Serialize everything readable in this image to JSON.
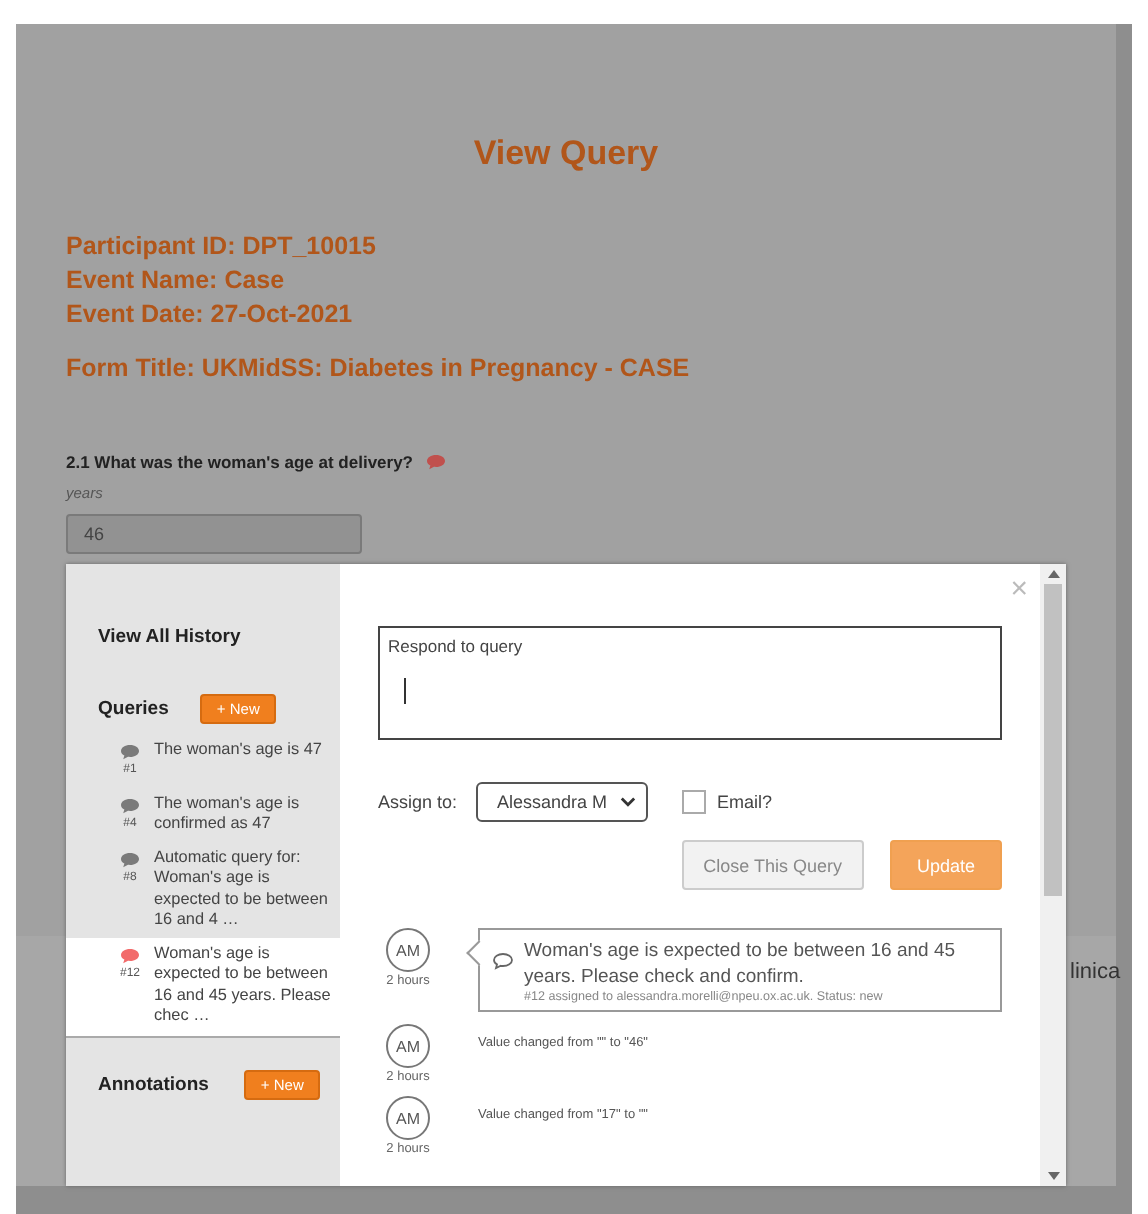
{
  "page": {
    "title": "View Query",
    "details": [
      "Participant ID: DPT_10015",
      "Event Name: Case",
      "Event Date: 27-Oct-2021"
    ],
    "form_title": "Form Title: UKMidSS: Diabetes in Pregnancy - CASE",
    "question": "2.1 What was the woman's age at delivery?",
    "unit": "years",
    "answer": "46",
    "behind_text": "linica"
  },
  "modal": {
    "history_link": "View All History",
    "queries": {
      "heading": "Queries",
      "new_button": "+ New",
      "items": [
        {
          "number": "#1",
          "text": "The woman's age is 47",
          "selected": false
        },
        {
          "number": "#4",
          "text": "The woman's age is confirmed as 47",
          "selected": false
        },
        {
          "number": "#8",
          "text": "Automatic query for: Woman's age is expected to be between 16 and 4 …",
          "selected": false
        },
        {
          "number": "#12",
          "text": "Woman's age is expected to be between 16 and 45 years. Please chec …",
          "selected": true
        }
      ]
    },
    "annotations": {
      "heading": "Annotations",
      "new_button": "+ New"
    },
    "close": "×",
    "response": {
      "label": "Respond to query"
    },
    "assign": {
      "label": "Assign to:",
      "value": "Alessandra M"
    },
    "email": {
      "label": "Email?",
      "checked": false
    },
    "buttons": [
      {
        "label": "Close This Query",
        "kind": "secondary"
      },
      {
        "label": "Update",
        "kind": "primary"
      }
    ],
    "history": [
      {
        "kind": "comment",
        "initials": "AM",
        "time": "2 hours",
        "text": "Woman's age is expected to be between 16 and 45 years. Please check and confirm.",
        "meta": "#12 assigned to alessandra.morelli@npeu.ox.ac.uk. Status: new"
      },
      {
        "kind": "change",
        "initials": "AM",
        "time": "2 hours",
        "text": "Value changed from \"\" to \"46\""
      },
      {
        "kind": "change",
        "initials": "AM",
        "time": "2 hours",
        "text": "Value changed from \"17\" to \"\""
      }
    ]
  }
}
